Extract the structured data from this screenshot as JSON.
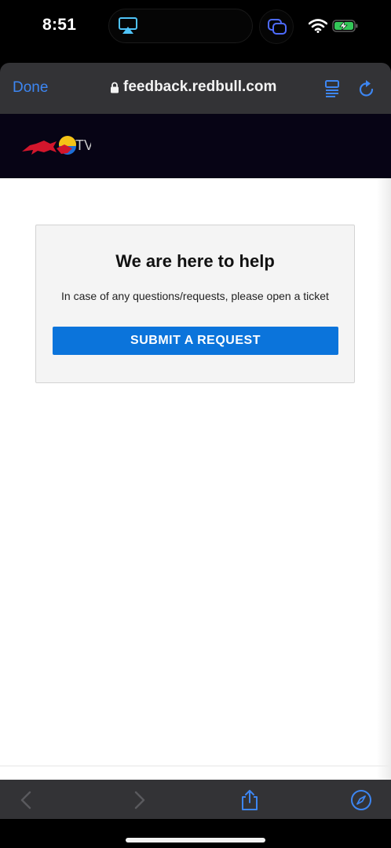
{
  "status_bar": {
    "time": "8:51",
    "icons": [
      "airplay-icon",
      "stack-icon",
      "wifi-icon",
      "battery-charging-icon"
    ]
  },
  "browser": {
    "done_label": "Done",
    "url": "feedback.redbull.com",
    "icons": [
      "lock-icon",
      "reader-icon",
      "reload-icon"
    ]
  },
  "site": {
    "logo": "redbull-tv-logo",
    "logo_text": "TV"
  },
  "card": {
    "title": "We are here to help",
    "text": "In case of any questions/requests, please open a ticket",
    "button_label": "SUBMIT A REQUEST"
  },
  "toolbar": {
    "icons": [
      "back-icon",
      "forward-icon",
      "share-icon",
      "compass-icon"
    ]
  },
  "colors": {
    "accent": "#0b74db",
    "link": "#3d86f2",
    "chrome": "#333336",
    "header": "#070415"
  }
}
